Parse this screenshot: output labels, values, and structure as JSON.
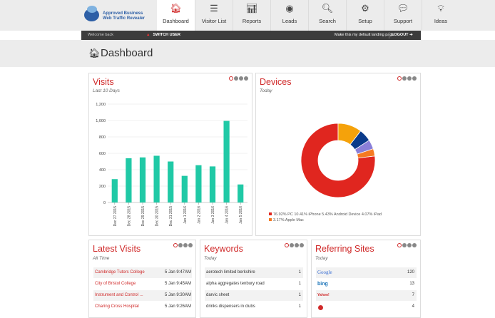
{
  "nav": {
    "logo_line1": "Approved Business",
    "logo_line2": "Web Traffic Revealer",
    "items": [
      {
        "label": "Dashboard",
        "icon": "home-icon",
        "glyph": "🏠︎"
      },
      {
        "label": "Visitor List",
        "icon": "list-icon",
        "glyph": "☰"
      },
      {
        "label": "Reports",
        "icon": "bar-chart-icon",
        "glyph": "📊︎"
      },
      {
        "label": "Leads",
        "icon": "target-icon",
        "glyph": "◉"
      },
      {
        "label": "Search",
        "icon": "search-icon",
        "glyph": "🔍︎"
      },
      {
        "label": "Setup",
        "icon": "gear-icon",
        "glyph": "⚙"
      },
      {
        "label": "Support",
        "icon": "chat-icon",
        "glyph": "💬︎"
      },
      {
        "label": "Ideas",
        "icon": "lightbulb-icon",
        "glyph": "💡︎"
      }
    ]
  },
  "subbar": {
    "welcome": "Welcome back",
    "switch_user": "SWITCH USER",
    "landing": "Make this my default landing page",
    "logout": "LOGOUT"
  },
  "page": {
    "title": "Dashboard"
  },
  "visits": {
    "title": "Visits",
    "subtitle": "Last 10 Days",
    "chart_data": {
      "type": "bar",
      "categories": [
        "Dec 27 2015",
        "Dec 28 2015",
        "Dec 29 2015",
        "Dec 30 2015",
        "Dec 31 2015",
        "Jan 1 2016",
        "Jan 2 2016",
        "Jan 3 2016",
        "Jan 4 2016",
        "Jan 5 2016"
      ],
      "values": [
        285,
        540,
        550,
        570,
        500,
        325,
        455,
        440,
        995,
        220
      ],
      "yticks": [
        "0",
        "200",
        "400",
        "600",
        "800",
        "1,000",
        "1,200"
      ],
      "ylim": [
        0,
        1200
      ],
      "color": "#20c9a6"
    }
  },
  "devices": {
    "title": "Devices",
    "subtitle": "Today",
    "chart_data": {
      "type": "pie",
      "slices": [
        {
          "name": "PC",
          "value": 76.92,
          "color": "#e0261f"
        },
        {
          "name": "iPhone",
          "value": 10.41,
          "color": "#f5a20a"
        },
        {
          "name": "Android Device",
          "value": 5.43,
          "color": "#0a3a8a"
        },
        {
          "name": "iPad",
          "value": 4.07,
          "color": "#8a7fd8"
        },
        {
          "name": "Apple Mac",
          "value": 3.17,
          "color": "#f57a22"
        }
      ]
    },
    "legend_line1": "76.92% PC    10.41% iPhone    5.43% Android Device    4.07% iPad",
    "legend_line2": "3.17% Apple Mac"
  },
  "latest": {
    "title": "Latest Visits",
    "subtitle": "All Time",
    "rows": [
      {
        "name": "Cambridge Tutors College",
        "time": "5 Jan 9:47AM"
      },
      {
        "name": "City of Bristol College",
        "time": "5 Jan 9:45AM"
      },
      {
        "name": "Instrument and Control ...",
        "time": "5 Jan 9:30AM"
      },
      {
        "name": "Charing Cross Hospital",
        "time": "5 Jan 9:26AM"
      }
    ]
  },
  "keywords": {
    "title": "Keywords",
    "subtitle": "Today",
    "rows": [
      {
        "kw": "aerotech limited berkshire",
        "count": "1"
      },
      {
        "kw": "alpha aggregates tenbury road",
        "count": "1"
      },
      {
        "kw": "darvic sheet",
        "count": "1"
      },
      {
        "kw": "drinks dispensers in clubs",
        "count": "1"
      }
    ]
  },
  "referring": {
    "title": "Referring Sites",
    "subtitle": "Today",
    "rows": [
      {
        "site": "Google",
        "count": "120",
        "color": "#3b6fd4"
      },
      {
        "site": "bing",
        "count": "13",
        "color": "#1a73b8"
      },
      {
        "site": "Yahoo!",
        "count": "7",
        "color": "#7b1fa2"
      },
      {
        "site": "",
        "count": "4",
        "color": "#d02a2a"
      }
    ]
  }
}
